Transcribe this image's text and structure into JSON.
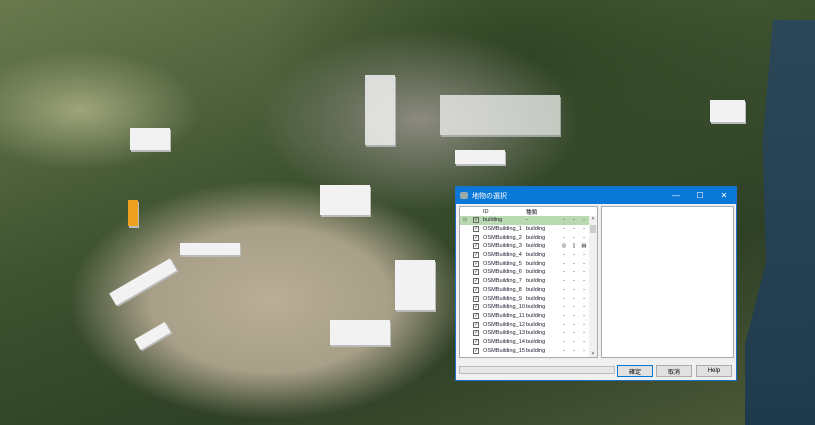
{
  "dialog": {
    "title": "地物の選択",
    "controls": [
      "—",
      "☐",
      "✕"
    ],
    "columns": {
      "id": "ID",
      "type": "種類"
    },
    "rows": [
      {
        "id": "building",
        "type": "-",
        "d": [
          "-",
          "-",
          "-"
        ],
        "checked": true,
        "expander": "⊟"
      },
      {
        "id": "OSMBuilding_1",
        "type": "building",
        "d": [
          "-",
          "-",
          "-"
        ],
        "checked": true
      },
      {
        "id": "OSMBuilding_2",
        "type": "building",
        "d": [
          "-",
          "-",
          "-"
        ],
        "checked": true
      },
      {
        "id": "OSMBuilding_3",
        "type": "building",
        "d": [
          "◎",
          "▯",
          "▤"
        ],
        "checked": true
      },
      {
        "id": "OSMBuilding_4",
        "type": "building",
        "d": [
          "-",
          "-",
          "-"
        ],
        "checked": true
      },
      {
        "id": "OSMBuilding_5",
        "type": "building",
        "d": [
          "-",
          "-",
          "-"
        ],
        "checked": true
      },
      {
        "id": "OSMBuilding_6",
        "type": "building",
        "d": [
          "-",
          "-",
          "-"
        ],
        "checked": true
      },
      {
        "id": "OSMBuilding_7",
        "type": "building",
        "d": [
          "-",
          "-",
          "-"
        ],
        "checked": true
      },
      {
        "id": "OSMBuilding_8",
        "type": "building",
        "d": [
          "-",
          "-",
          "-"
        ],
        "checked": true
      },
      {
        "id": "OSMBuilding_9",
        "type": "building",
        "d": [
          "-",
          "-",
          "-"
        ],
        "checked": true
      },
      {
        "id": "OSMBuilding_10",
        "type": "building",
        "d": [
          "-",
          "-",
          "-"
        ],
        "checked": true
      },
      {
        "id": "OSMBuilding_11",
        "type": "building",
        "d": [
          "-",
          "-",
          "-"
        ],
        "checked": true
      },
      {
        "id": "OSMBuilding_12",
        "type": "building",
        "d": [
          "-",
          "-",
          "-"
        ],
        "checked": true
      },
      {
        "id": "OSMBuilding_13",
        "type": "building",
        "d": [
          "-",
          "-",
          "-"
        ],
        "checked": true
      },
      {
        "id": "OSMBuilding_14",
        "type": "building",
        "d": [
          "-",
          "-",
          "-"
        ],
        "checked": true
      },
      {
        "id": "OSMBuilding_15",
        "type": "building",
        "d": [
          "-",
          "-",
          "-"
        ],
        "checked": true
      }
    ],
    "buttons": {
      "ok": "確定",
      "cancel": "取消",
      "help": "Help"
    },
    "progress": 0,
    "accent": "#0078d7"
  }
}
